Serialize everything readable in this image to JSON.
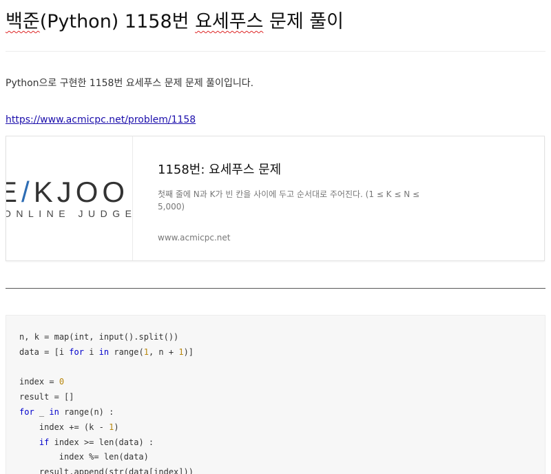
{
  "post": {
    "title_underlined": "백준",
    "title_rest": "(Python) 1158번 ",
    "title_underlined2": "요세푸스",
    "title_tail": " 문제 풀이",
    "intro": "Python으로 구현한 1158번 요세푸스 문제 문제 풀이입니다.",
    "link": "https://www.acmicpc.net/problem/1158"
  },
  "og_card": {
    "logo_prefix": "E",
    "logo_accent": "/",
    "logo_suffix": "KJOO",
    "logo_sub": "ONLINE JUDGE",
    "title": "1158번: 요세푸스 문제",
    "description": "첫째 줄에 N과 K가 빈 칸을 사이에 두고 순서대로 주어진다. (1 ≤ K ≤ N ≤ 5,000)",
    "host": "www.acmicpc.net"
  },
  "code": {
    "language": "python",
    "lines": [
      "n, k = map(int, input().split())",
      "data = [i for i in range(1, n + 1)]",
      "",
      "index = 0",
      "result = []",
      "for _ in range(n) :",
      "    index += (k - 1)",
      "    if index >= len(data) :",
      "        index %= len(data)",
      "    result.append(str(data[index]))"
    ]
  },
  "colors": {
    "keyword": "#0000cc",
    "number": "#b8860b",
    "link": "#1a0dab",
    "logo_accent": "#2e6db4"
  }
}
